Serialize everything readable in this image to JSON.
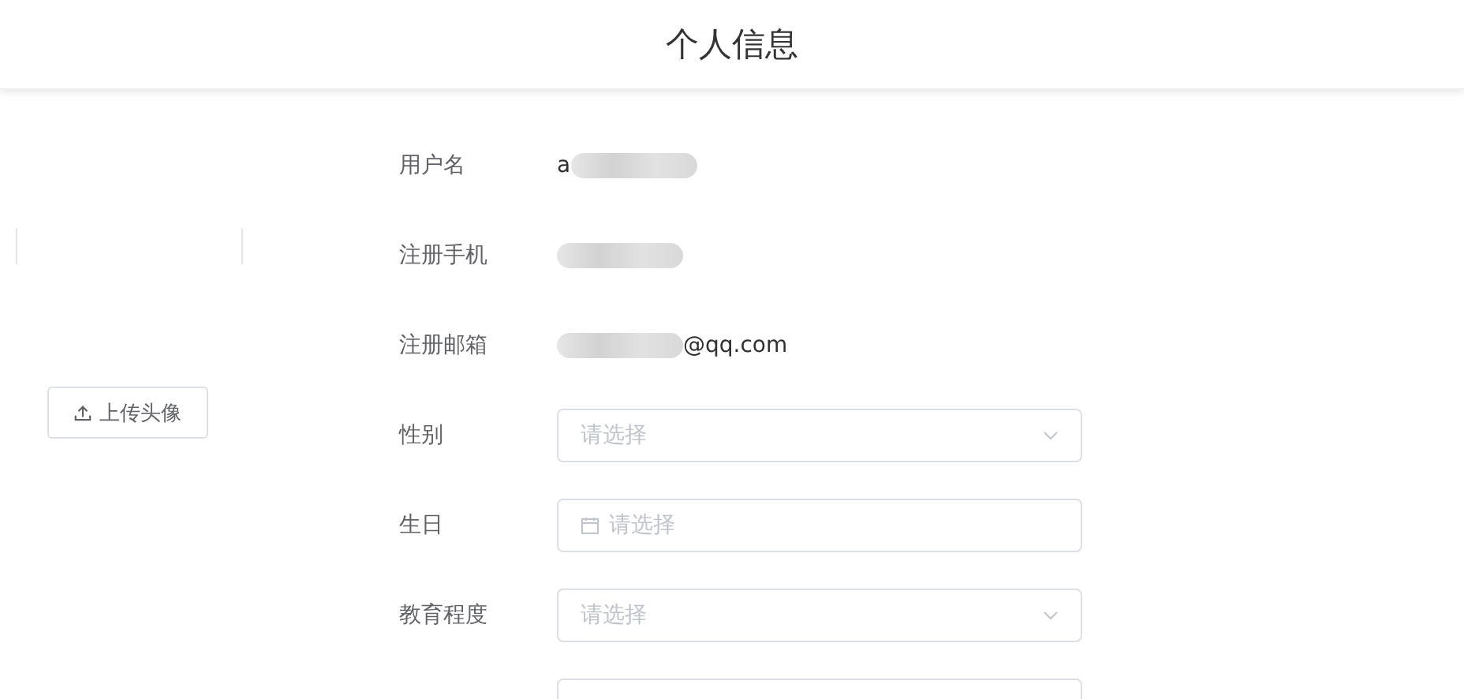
{
  "header": {
    "title": "个人信息"
  },
  "avatar": {
    "upload_button": "上传头像"
  },
  "fields": [
    {
      "kind": "text",
      "label": "用户名",
      "value": "a",
      "redacted_after": true
    },
    {
      "kind": "text",
      "label": "注册手机",
      "redacted_before": true
    },
    {
      "kind": "text",
      "label": "注册邮箱",
      "value": "@qq.com",
      "redacted_before": true
    },
    {
      "kind": "select",
      "label": "性别",
      "placeholder": "请选择"
    },
    {
      "kind": "date",
      "label": "生日",
      "placeholder": "请选择"
    },
    {
      "kind": "select",
      "label": "教育程度",
      "placeholder": "请选择"
    },
    {
      "kind": "input"
    }
  ]
}
